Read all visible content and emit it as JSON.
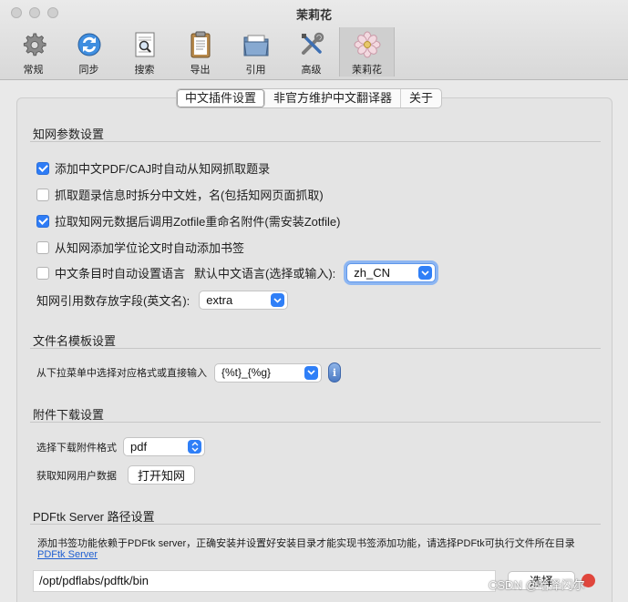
{
  "window": {
    "title": "茉莉花"
  },
  "toolbar": [
    {
      "label": "常规",
      "icon": "gear-icon"
    },
    {
      "label": "同步",
      "icon": "sync-icon"
    },
    {
      "label": "搜索",
      "icon": "search-document-icon"
    },
    {
      "label": "导出",
      "icon": "clipboard-icon"
    },
    {
      "label": "引用",
      "icon": "folder-icon"
    },
    {
      "label": "高级",
      "icon": "tools-icon"
    },
    {
      "label": "茉莉花",
      "icon": "jasmine-flower-icon",
      "active": true
    }
  ],
  "tabs": [
    {
      "label": "中文插件设置",
      "active": true
    },
    {
      "label": "非官方维护中文翻译器"
    },
    {
      "label": "关于"
    }
  ],
  "cnki": {
    "heading": "知网参数设置",
    "options": [
      {
        "label": "添加中文PDF/CAJ时自动从知网抓取题录",
        "checked": true
      },
      {
        "label": "抓取题录信息时拆分中文姓，名(包括知网页面抓取)",
        "checked": false
      },
      {
        "label": "拉取知网元数据后调用Zotfile重命名附件(需安装Zotfile)",
        "checked": true
      },
      {
        "label": "从知网添加学位论文时自动添加书签",
        "checked": false
      },
      {
        "label": "中文条目时自动设置语言",
        "checked": false
      }
    ],
    "default_lang_label": "默认中文语言(选择或输入):",
    "default_lang_value": "zh_CN",
    "cite_field_label": "知网引用数存放字段(英文名):",
    "cite_field_value": "extra"
  },
  "filename": {
    "heading": "文件名模板设置",
    "desc": "从下拉菜单中选择对应格式或直接输入",
    "value": "{%t}_{%g}",
    "info_glyph": "i"
  },
  "attachment": {
    "heading": "附件下载设置",
    "format_label": "选择下载附件格式",
    "format_value": "pdf",
    "user_data_label": "获取知网用户数据",
    "open_button": "打开知网"
  },
  "pdftk": {
    "heading": "PDFtk Server 路径设置",
    "desc": "添加书签功能依赖于PDFtk server，正确安装并设置好安装目录才能实现书签添加功能，请选择PDFtk可执行文件所在目录",
    "link": "PDFtk Server",
    "path": "/opt/pdflabs/pdftk/bin",
    "choose_button": "选择"
  },
  "watermark": "CSDN @哈泽闪尔",
  "colors": {
    "accent": "#2e7cf6",
    "link": "#1f5fd1",
    "panel": "#e4e4e4"
  }
}
